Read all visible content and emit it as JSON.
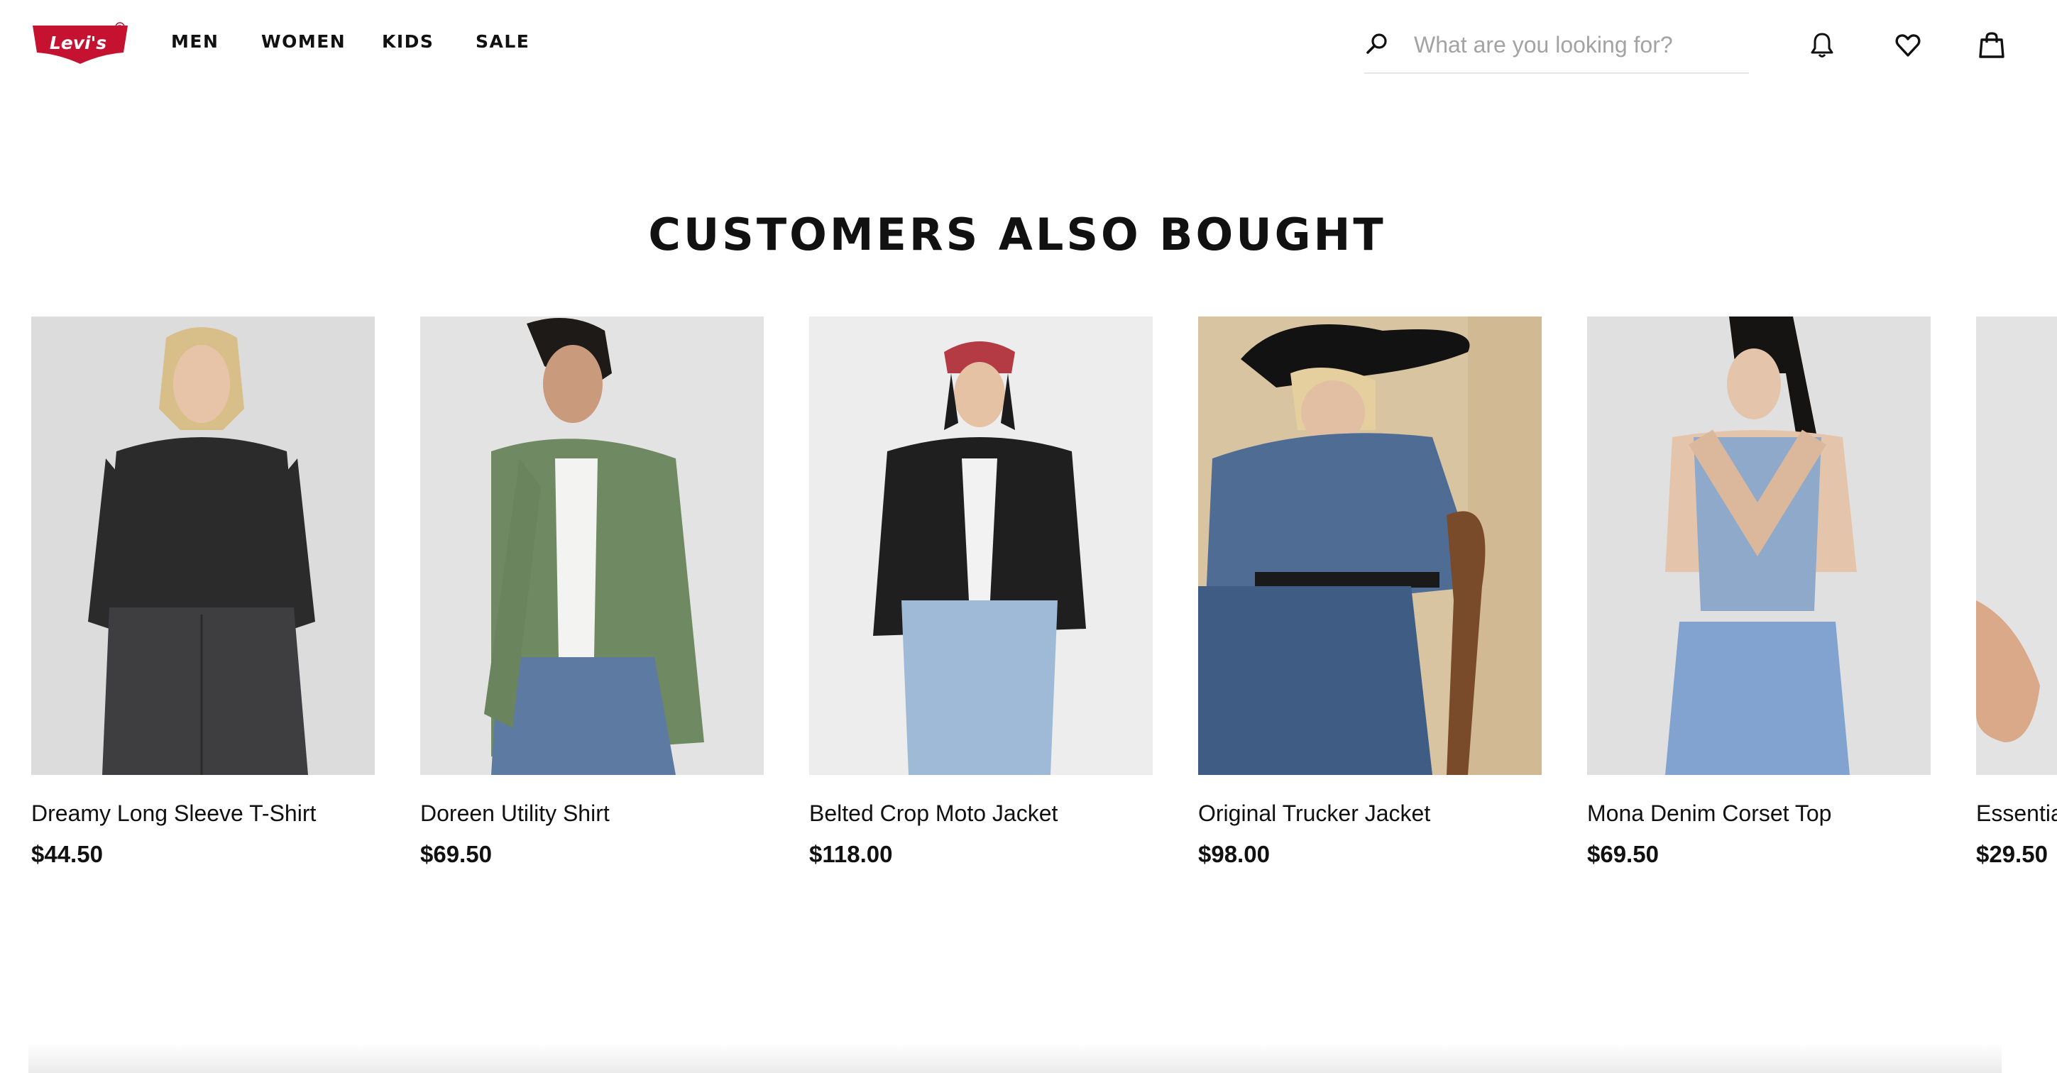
{
  "brand": {
    "logo_text": "Levi's",
    "accent": "#c41230"
  },
  "nav": {
    "items": [
      "MEN",
      "WOMEN",
      "KIDS",
      "SALE"
    ]
  },
  "search": {
    "placeholder": "What are you looking for?"
  },
  "header_icons": [
    "bell-icon",
    "heart-icon",
    "bag-icon"
  ],
  "section": {
    "title": "CUSTOMERS ALSO BOUGHT"
  },
  "products": [
    {
      "name": "Dreamy Long Sleeve T-Shirt",
      "price": "$44.50"
    },
    {
      "name": "Doreen Utility Shirt",
      "price": "$69.50"
    },
    {
      "name": "Belted Crop Moto Jacket",
      "price": "$118.00"
    },
    {
      "name": "Original Trucker Jacket",
      "price": "$98.00"
    },
    {
      "name": "Mona Denim Corset Top",
      "price": "$69.50"
    },
    {
      "name": "Essentia",
      "price": "$29.50"
    }
  ]
}
